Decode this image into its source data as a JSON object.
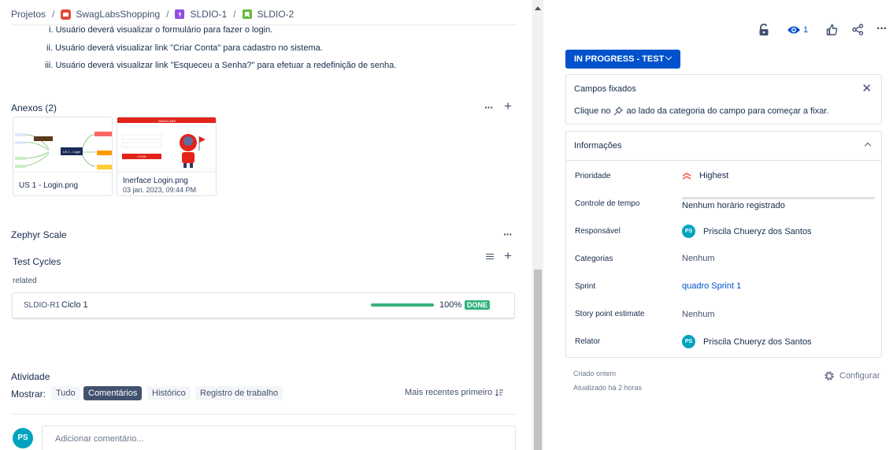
{
  "breadcrumb": {
    "items": [
      {
        "label": "Projetos"
      },
      {
        "label": "SwagLabsShopping"
      },
      {
        "label": "SLDIO-1"
      },
      {
        "label": "SLDIO-2"
      }
    ],
    "separator": "/"
  },
  "description": {
    "items": [
      {
        "marker": "i.",
        "text": "Usuário deverá visualizar o formulário para fazer o login."
      },
      {
        "marker": "ii.",
        "text": "Usuário deverá visualizar link \"Criar Conta\" para cadastro no sistema."
      },
      {
        "marker": "iii.",
        "text": "Usuário deverá visualizar link \"Esqueceu a Senha?\" para efetuar a redefinição de senha."
      }
    ]
  },
  "attachments": {
    "title": "Anexos (2)",
    "files": [
      {
        "name": "US 1 - Login.png",
        "date": "",
        "thumb_label": "US 1 - Login"
      },
      {
        "name": "Inerface Login.png",
        "date": "03 jan. 2023, 09:44 PM",
        "thumb_brand": "SWAGLABS",
        "thumb_button": "LOGIN"
      }
    ]
  },
  "zephyr": {
    "title": "Zephyr Scale",
    "test_cycles_title": "Test Cycles",
    "related_label": "related",
    "cycle": {
      "key": "SLDIO-R1",
      "name": "Ciclo 1",
      "progress": 100,
      "progress_label": "100%",
      "status": "DONE"
    }
  },
  "activity": {
    "title": "Atividade",
    "show_label": "Mostrar:",
    "filters": [
      {
        "label": "Tudo",
        "active": false
      },
      {
        "label": "Comentários",
        "active": true
      },
      {
        "label": "Histórico",
        "active": false
      },
      {
        "label": "Registro de trabalho",
        "active": false
      }
    ],
    "sort_label": "Mais recentes primeiro",
    "comment_placeholder": "Adicionar comentário...",
    "avatar_initials": "PS"
  },
  "right": {
    "watch_count": "1",
    "status_label": "IN PROGRESS - TEST",
    "pinned": {
      "title": "Campos fixados",
      "hint_before": "Clique no",
      "hint_after": "ao lado da categoria do campo para começar a fixar."
    },
    "info": {
      "title": "Informações",
      "fields": {
        "priority_label": "Prioridade",
        "priority_value": "Highest",
        "time_label": "Controle de tempo",
        "time_value": "Nenhum horário registrado",
        "assignee_label": "Responsável",
        "assignee_value": "Priscila Chueryz dos Santos",
        "assignee_initials": "PS",
        "categories_label": "Categorias",
        "categories_value": "Nenhum",
        "sprint_label": "Sprint",
        "sprint_value": "quadro Sprint 1",
        "story_label": "Story point estimate",
        "story_value": "Nenhum",
        "reporter_label": "Relator",
        "reporter_value": "Priscila Chueryz dos Santos",
        "reporter_initials": "PS"
      }
    },
    "created": "Criado ontem",
    "updated": "Atualizado há 2 horas",
    "configure_label": "Configurar"
  },
  "colors": {
    "primary": "#0052cc",
    "success": "#36b37e",
    "avatar": "#00a3bf",
    "priority": "#ff5630"
  }
}
